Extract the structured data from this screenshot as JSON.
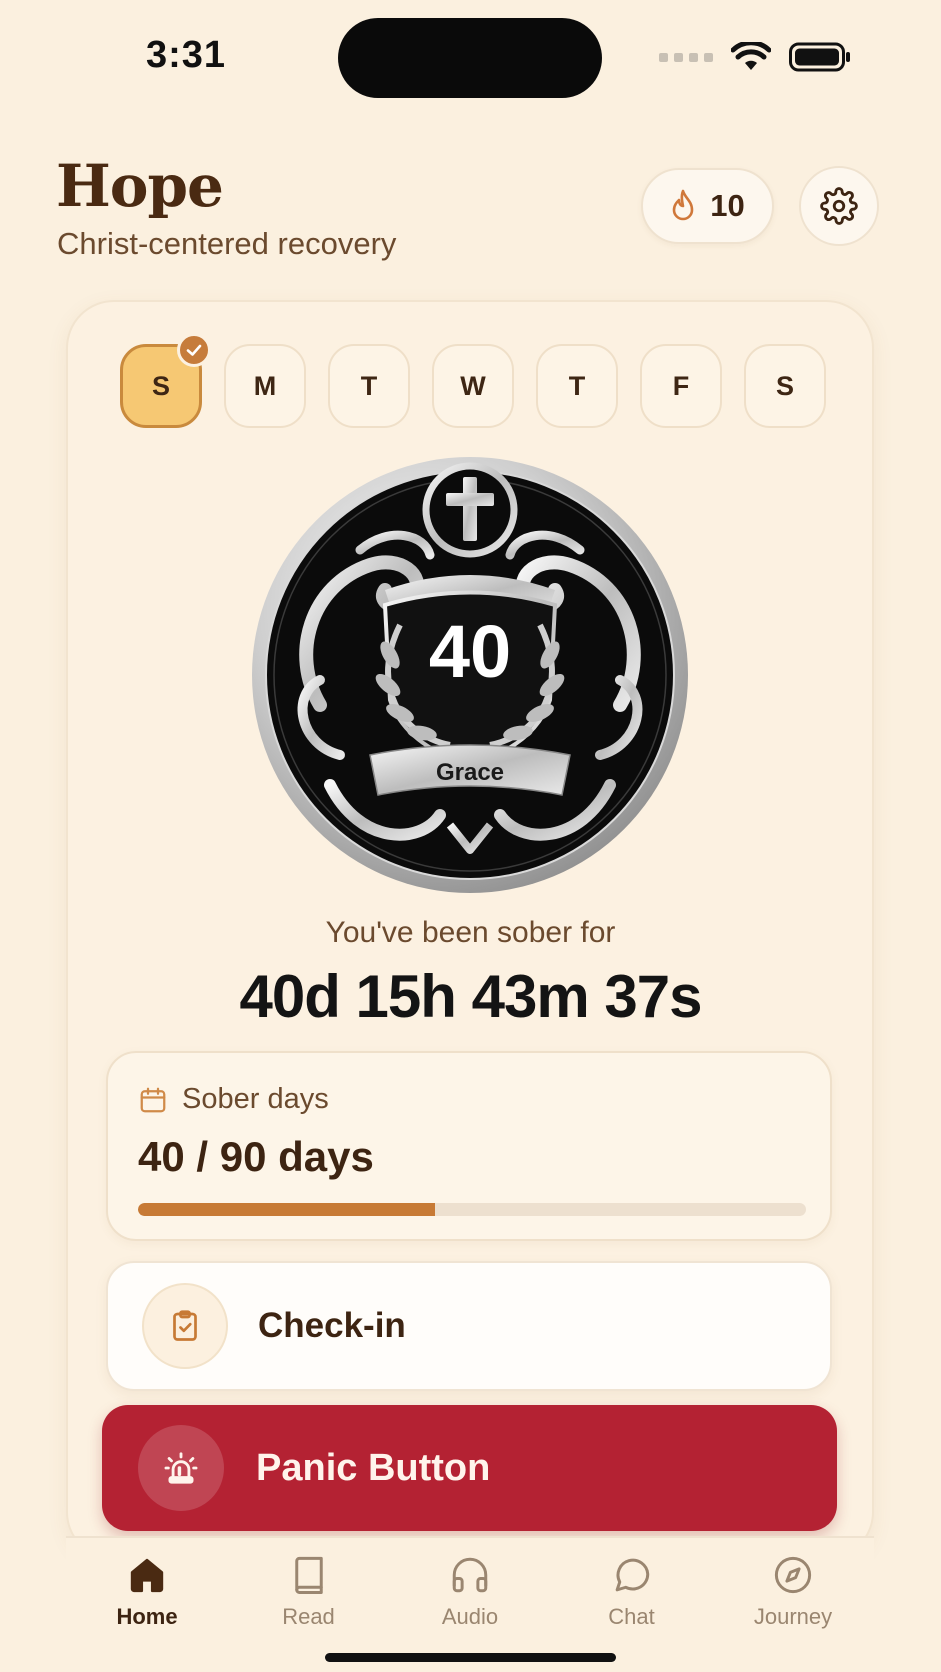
{
  "status_bar": {
    "time": "3:31",
    "icons": [
      "signal-dots-icon",
      "wifi-icon",
      "battery-icon"
    ]
  },
  "header": {
    "title": "Hope",
    "subtitle": "Christ-centered recovery",
    "streak": {
      "icon": "flame-icon",
      "count": "10"
    },
    "settings_icon": "gear-icon"
  },
  "week": {
    "days": [
      {
        "label": "S",
        "completed": true
      },
      {
        "label": "M",
        "completed": false
      },
      {
        "label": "T",
        "completed": false
      },
      {
        "label": "W",
        "completed": false
      },
      {
        "label": "T",
        "completed": false
      },
      {
        "label": "F",
        "completed": false
      },
      {
        "label": "S",
        "completed": false
      }
    ]
  },
  "coin": {
    "number": "40",
    "banner": "Grace"
  },
  "sobriety": {
    "label": "You've been sober for",
    "timer": "40d 15h 43m 37s"
  },
  "sober_days": {
    "icon": "calendar-icon",
    "label": "Sober days",
    "value": "40 / 90 days",
    "progress": 0.444
  },
  "actions": {
    "checkin": {
      "icon": "clipboard-check-icon",
      "label": "Check-in"
    },
    "panic": {
      "icon": "siren-icon",
      "label": "Panic Button"
    }
  },
  "tabs": [
    {
      "label": "Home",
      "icon": "home-icon",
      "active": true
    },
    {
      "label": "Read",
      "icon": "book-icon",
      "active": false
    },
    {
      "label": "Audio",
      "icon": "headphones-icon",
      "active": false
    },
    {
      "label": "Chat",
      "icon": "chat-bubble-icon",
      "active": false
    },
    {
      "label": "Journey",
      "icon": "compass-icon",
      "active": false
    }
  ],
  "colors": {
    "background": "#fbf0df",
    "accent": "#c77a35",
    "panic": "#b42233",
    "active_day": "#f6c873",
    "text_dark": "#3d2412"
  }
}
